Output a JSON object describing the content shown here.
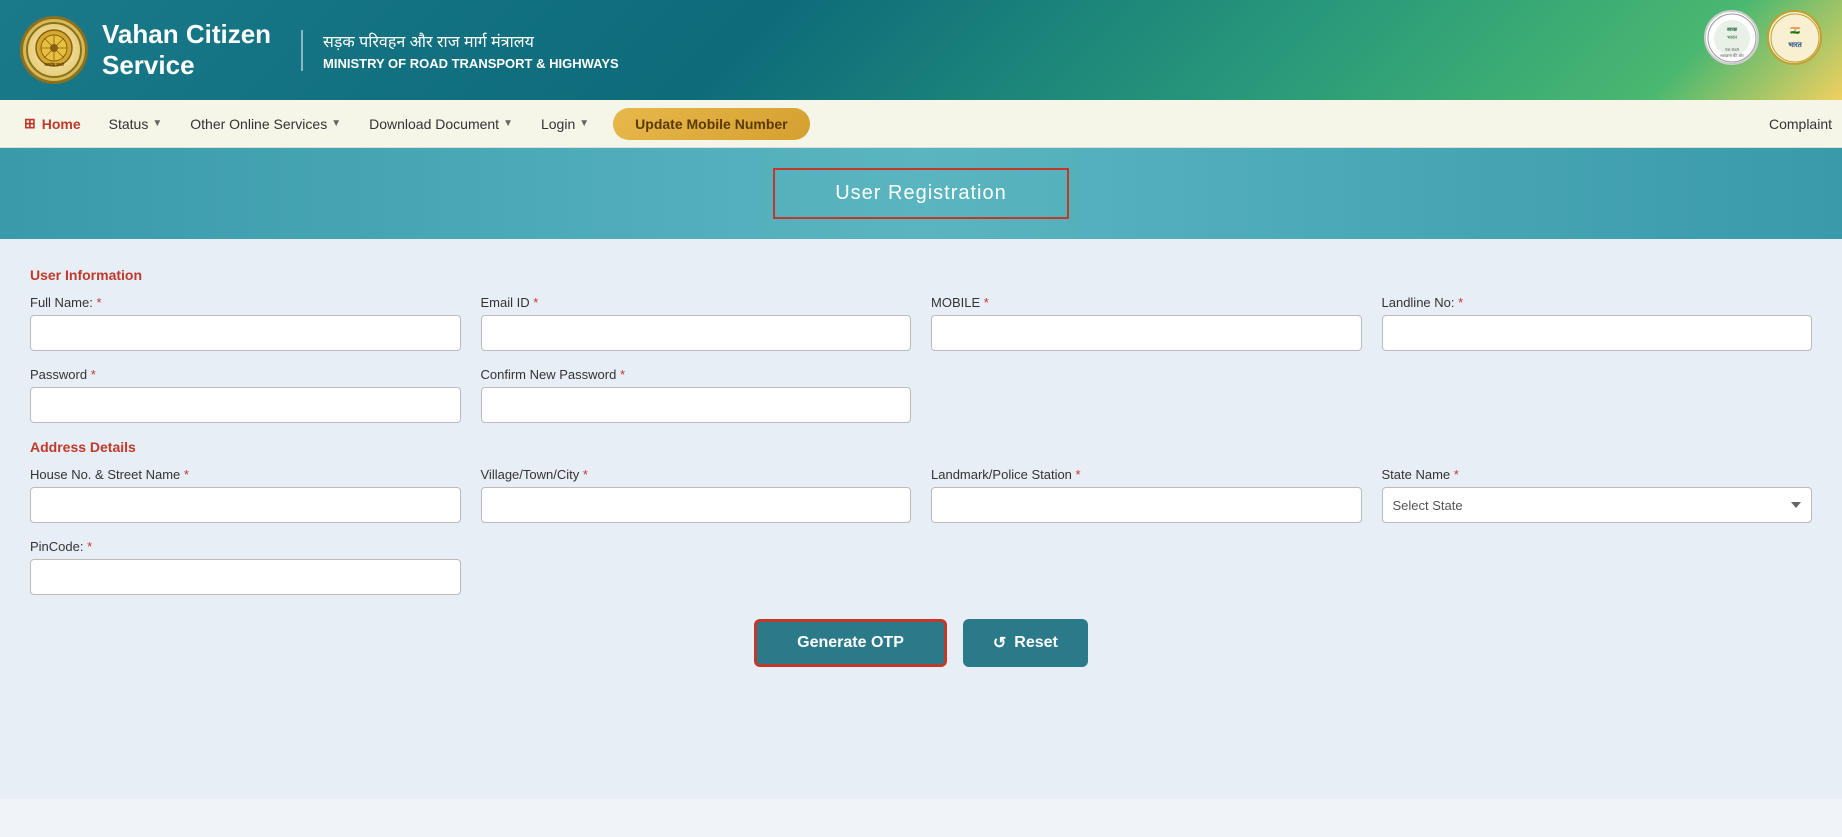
{
  "header": {
    "hindi_title": "सड़क परिवहन और राज मार्ग मंत्रालय",
    "english_title": "MINISTRY OF ROAD TRANSPORT & HIGHWAYS",
    "app_name_line1": "Vahan Citizen",
    "app_name_line2": "Service"
  },
  "navbar": {
    "home_label": "Home",
    "status_label": "Status",
    "other_services_label": "Other Online Services",
    "download_document_label": "Download Document",
    "login_label": "Login",
    "update_mobile_label": "Update Mobile Number",
    "complaint_label": "Complaint"
  },
  "page": {
    "banner_title": "User Registration"
  },
  "form": {
    "user_info_section": "User Information",
    "address_section": "Address Details",
    "full_name_label": "Full Name:",
    "email_label": "Email ID",
    "mobile_label": "MOBILE",
    "landline_label": "Landline No:",
    "password_label": "Password",
    "confirm_password_label": "Confirm New Password",
    "house_label": "House No. & Street Name",
    "village_label": "Village/Town/City",
    "landmark_label": "Landmark/Police Station",
    "state_label": "State Name",
    "pincode_label": "PinCode:",
    "state_placeholder": "Select State",
    "generate_otp_label": "Generate OTP",
    "reset_label": "Reset",
    "required_star": "*"
  }
}
